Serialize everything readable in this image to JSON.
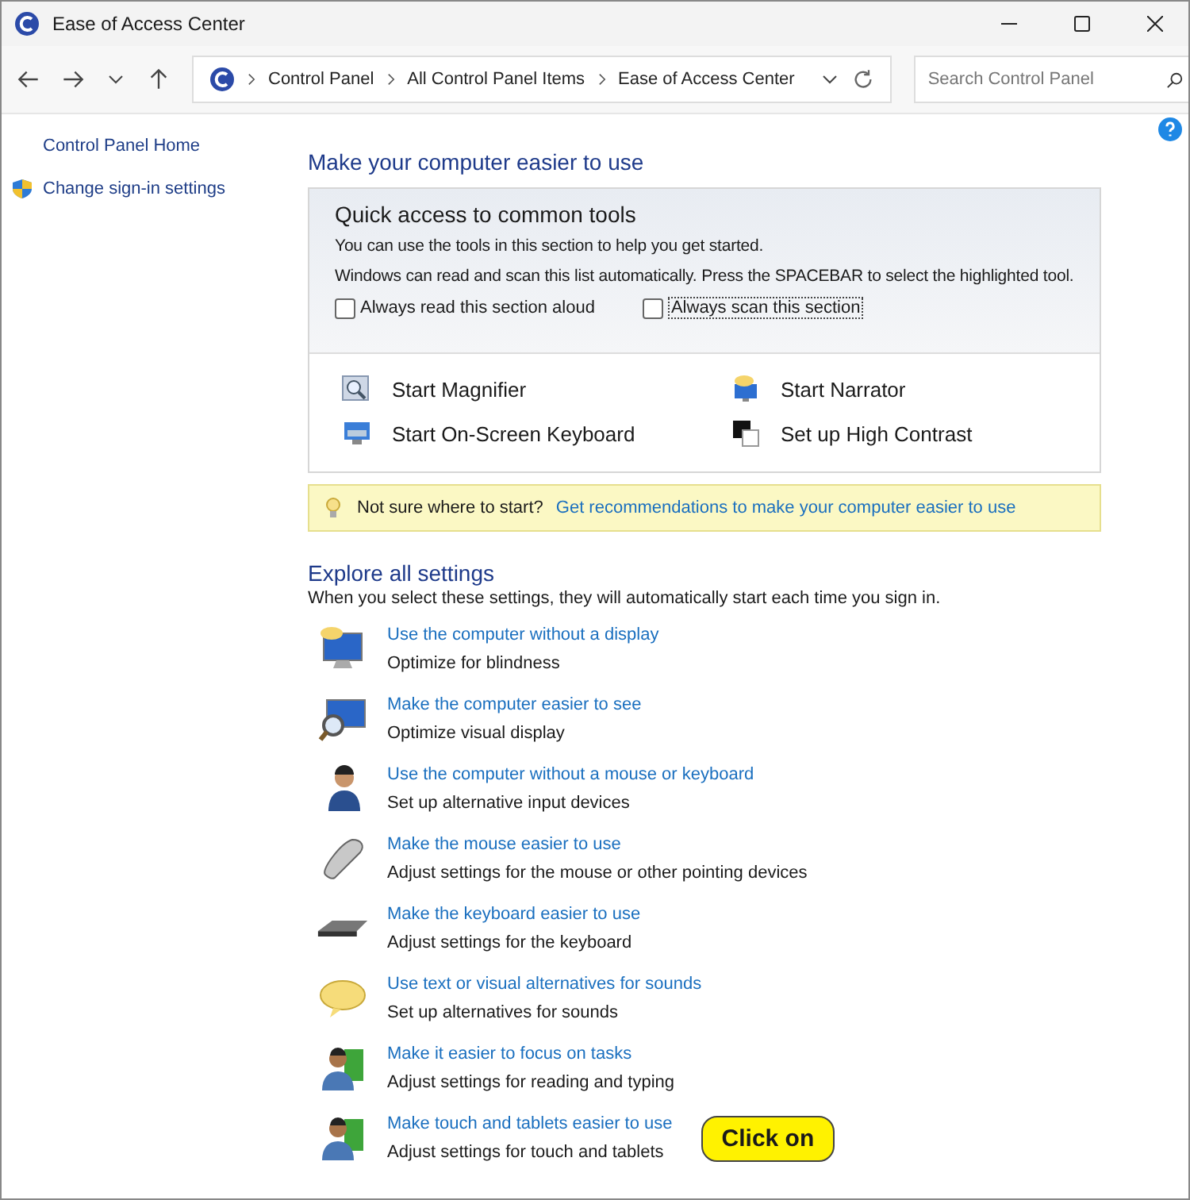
{
  "window": {
    "title": "Ease of Access Center"
  },
  "address": {
    "crumbs": [
      "Control Panel",
      "All Control Panel Items",
      "Ease of Access Center"
    ]
  },
  "search": {
    "placeholder": "Search Control Panel"
  },
  "sidebar": {
    "items": [
      {
        "label": "Control Panel Home",
        "kind": "plain"
      },
      {
        "label": "Change sign-in settings",
        "kind": "shield"
      }
    ]
  },
  "heading": "Make your computer easier to use",
  "quick_access": {
    "title": "Quick access to common tools",
    "lines": [
      "You can use the tools in this section to help you get started.",
      "Windows can read and scan this list automatically.  Press the SPACEBAR to select the highlighted tool."
    ],
    "options": [
      {
        "label": "Always read this section aloud",
        "checked": false
      },
      {
        "label": "Always scan this section",
        "checked": false
      }
    ],
    "tools": [
      {
        "label": "Start Magnifier",
        "kind": "magnifier"
      },
      {
        "label": "Start Narrator",
        "kind": "narrator"
      },
      {
        "label": "Start On-Screen Keyboard",
        "kind": "keyboard"
      },
      {
        "label": "Set up High Contrast",
        "kind": "contrast"
      }
    ]
  },
  "tip": {
    "text": "Not sure where to start?",
    "link": "Get recommendations to make your computer easier to use"
  },
  "explore": {
    "title": "Explore all settings",
    "subtitle": "When you select these settings, they will automatically start each time you sign in.",
    "items": [
      {
        "link": "Use the computer without a display",
        "desc": "Optimize for blindness",
        "kind": "display"
      },
      {
        "link": "Make the computer easier to see",
        "desc": "Optimize visual display",
        "kind": "see"
      },
      {
        "link": "Use the computer without a mouse or keyboard",
        "desc": "Set up alternative input devices",
        "kind": "person"
      },
      {
        "link": "Make the mouse easier to use",
        "desc": "Adjust settings for the mouse or other pointing devices",
        "kind": "mouse"
      },
      {
        "link": "Make the keyboard easier to use",
        "desc": "Adjust settings for the keyboard",
        "kind": "keyboard"
      },
      {
        "link": "Use text or visual alternatives for sounds",
        "desc": "Set up alternatives for sounds",
        "kind": "bubble"
      },
      {
        "link": "Make it easier to focus on tasks",
        "desc": "Adjust settings for reading and typing",
        "kind": "people"
      },
      {
        "link": "Make touch and tablets easier to use",
        "desc": "Adjust settings for touch and tablets",
        "kind": "people",
        "callout": "Click on"
      }
    ]
  }
}
